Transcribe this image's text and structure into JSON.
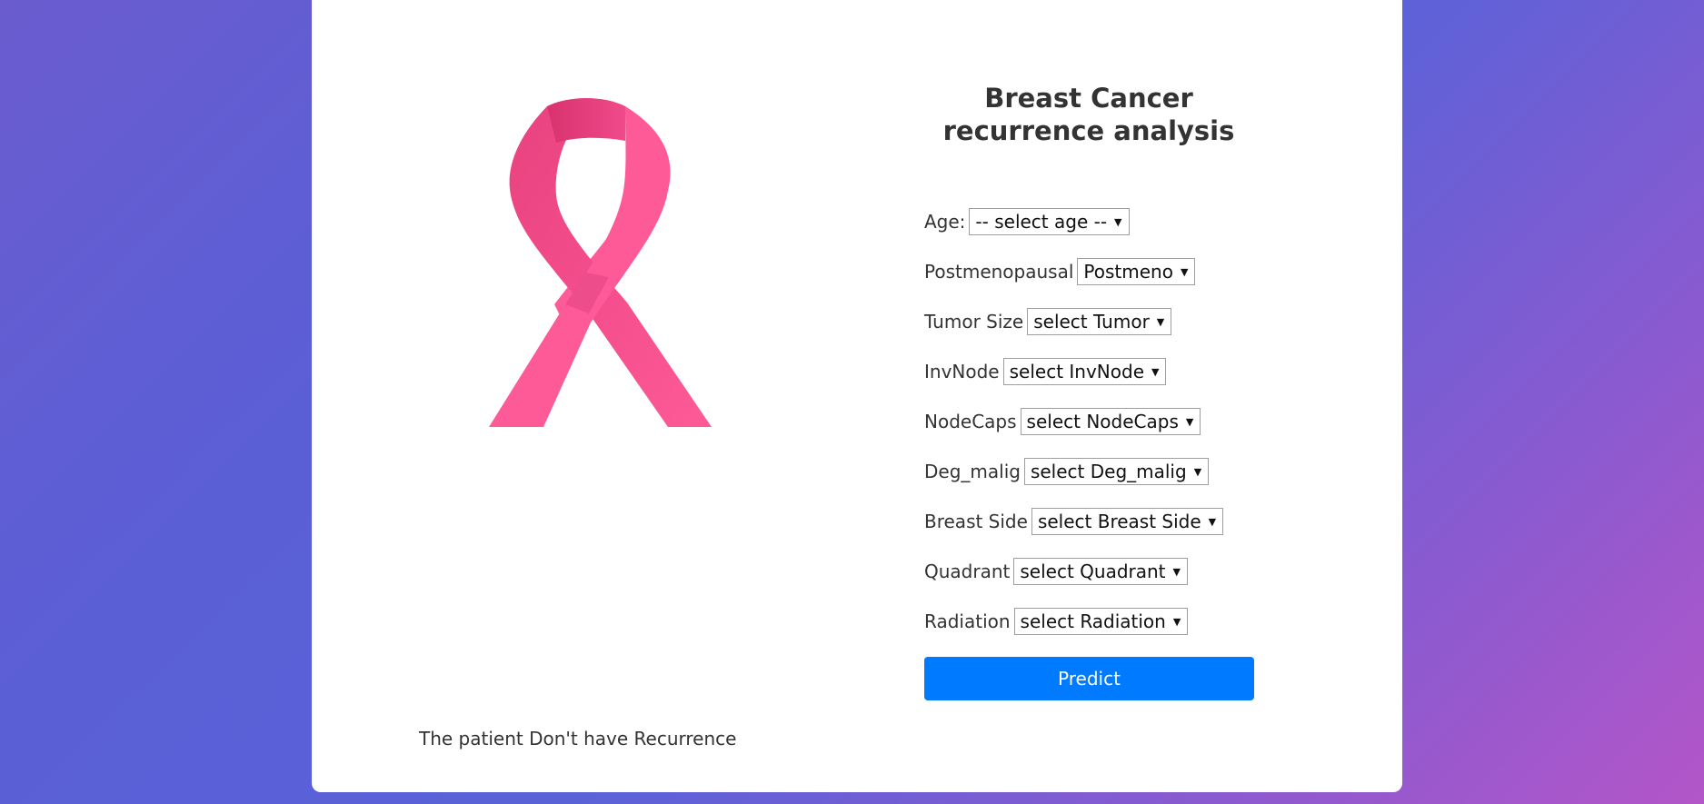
{
  "page": {
    "title": "Breast Cancer recurrence analysis",
    "title_line1": "Breast Cancer",
    "title_line2": "recurrence analysis",
    "accent_color": "#007bff",
    "ribbon_color": "#ff5a98"
  },
  "form": {
    "fields": [
      {
        "label": "Age:",
        "value": "-- select age --"
      },
      {
        "label": "Postmenopausal",
        "value": "Postmeno"
      },
      {
        "label": "Tumor Size",
        "value": "select Tumor"
      },
      {
        "label": "InvNode",
        "value": "select InvNode"
      },
      {
        "label": "NodeCaps",
        "value": "select NodeCaps"
      },
      {
        "label": "Deg_malig",
        "value": "select Deg_malig"
      },
      {
        "label": "Breast Side",
        "value": "select Breast Side"
      },
      {
        "label": "Quadrant",
        "value": "select Quadrant"
      },
      {
        "label": "Radiation",
        "value": "select Radiation"
      }
    ],
    "submit_label": "Predict"
  },
  "result": {
    "text": "The patient Don't have Recurrence"
  },
  "icons": {
    "ribbon": "pink-awareness-ribbon-icon",
    "dropdown_arrow": "triangle-down-icon"
  }
}
